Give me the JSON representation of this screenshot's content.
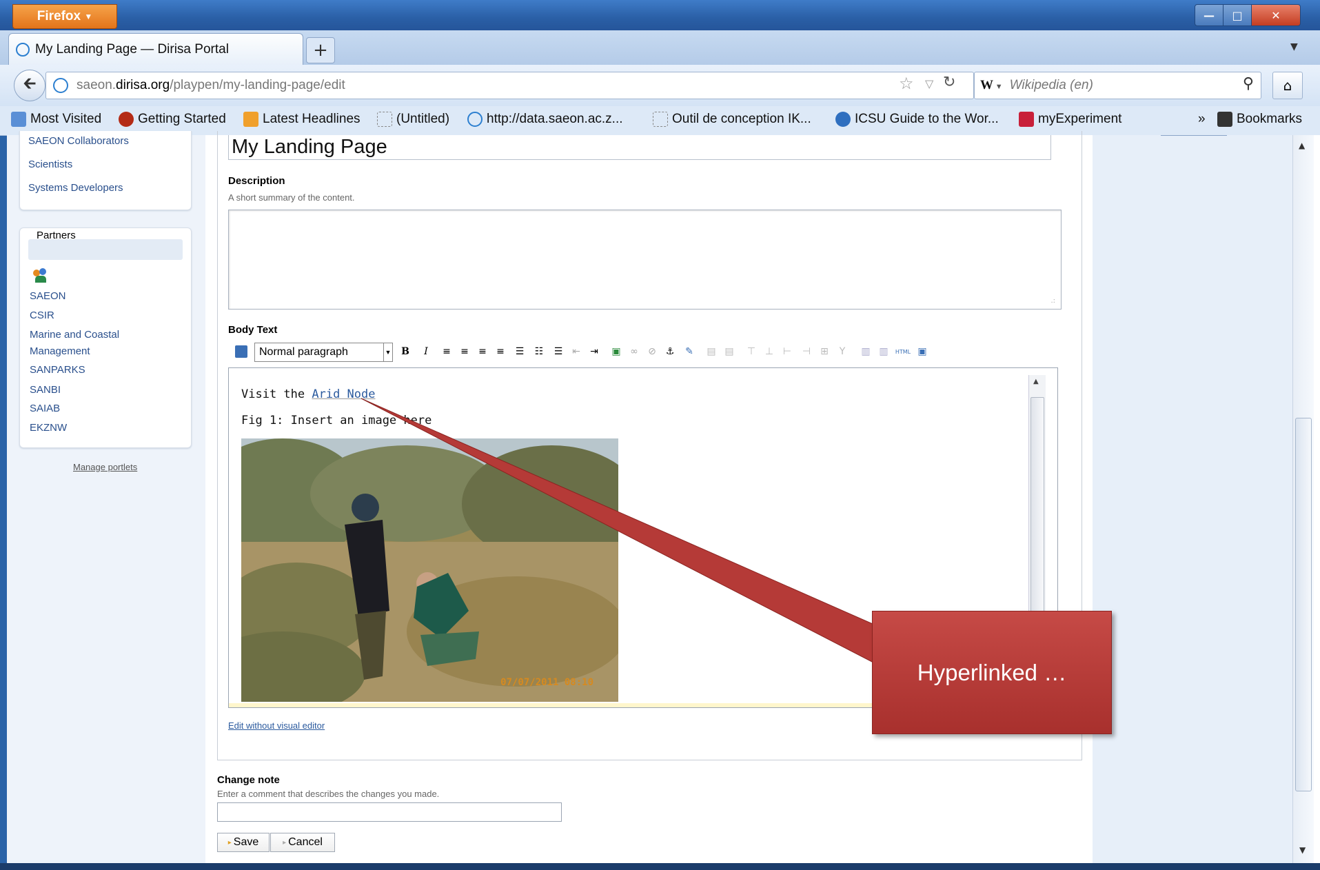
{
  "browser": {
    "menu_label": "Firefox",
    "tab_title": "My Landing Page — Dirisa Portal",
    "new_tab": "+",
    "url_host": "saeon.",
    "url_domain": "dirisa.org",
    "url_path": "/playpen/my-landing-page/edit",
    "search_engine": "W",
    "search_placeholder": "Wikipedia (en)"
  },
  "bookmarks": [
    {
      "label": "Most Visited",
      "icon": "most-visited-icon"
    },
    {
      "label": "Getting Started",
      "icon": "firefox-icon"
    },
    {
      "label": "Latest Headlines",
      "icon": "rss-icon"
    },
    {
      "label": "(Untitled)",
      "icon": "blank-page-icon"
    },
    {
      "label": "http://data.saeon.ac.z...",
      "icon": "saeon-icon"
    },
    {
      "label": "Outil de conception IK...",
      "icon": "blank-page-icon"
    },
    {
      "label": "ICSU Guide to the Wor...",
      "icon": "noaa-icon"
    },
    {
      "label": "myExperiment",
      "icon": "myexperiment-icon"
    },
    {
      "label": "Bookmarks",
      "icon": "bookmarks-icon"
    }
  ],
  "overflow_chevron": "»",
  "sidebar": {
    "top_items": [
      "SAEON Collaborators",
      "Scientists",
      "Systems Developers"
    ],
    "partners_title": "Partners",
    "partners": [
      "SAEON",
      "CSIR",
      "Marine and Coastal",
      "Management",
      "SANPARKS",
      "SANBI",
      "SAIAB",
      "EKZNW"
    ],
    "manage_portlets": "Manage portlets"
  },
  "form": {
    "title_value": "My Landing Page",
    "description_label": "Description",
    "description_help": "A short summary of the content.",
    "body_label": "Body Text",
    "paragraph_style": "Normal paragraph",
    "visit_text": "Visit the ",
    "link_text": "Arid Node",
    "fig_caption": "Fig 1: Insert an image here",
    "photo_timestamp": "07/07/2011 08:10",
    "edit_without_visual": "Edit without visual editor",
    "change_note_label": "Change note",
    "change_note_help": "Enter a comment that describes the changes you made.",
    "save_label": "Save",
    "cancel_label": "Cancel"
  },
  "callout": {
    "text": "Hyperlinked …"
  },
  "colors": {
    "callout": "#b53a37",
    "link": "#2b5a9e",
    "chrome": "#2a63a8"
  }
}
